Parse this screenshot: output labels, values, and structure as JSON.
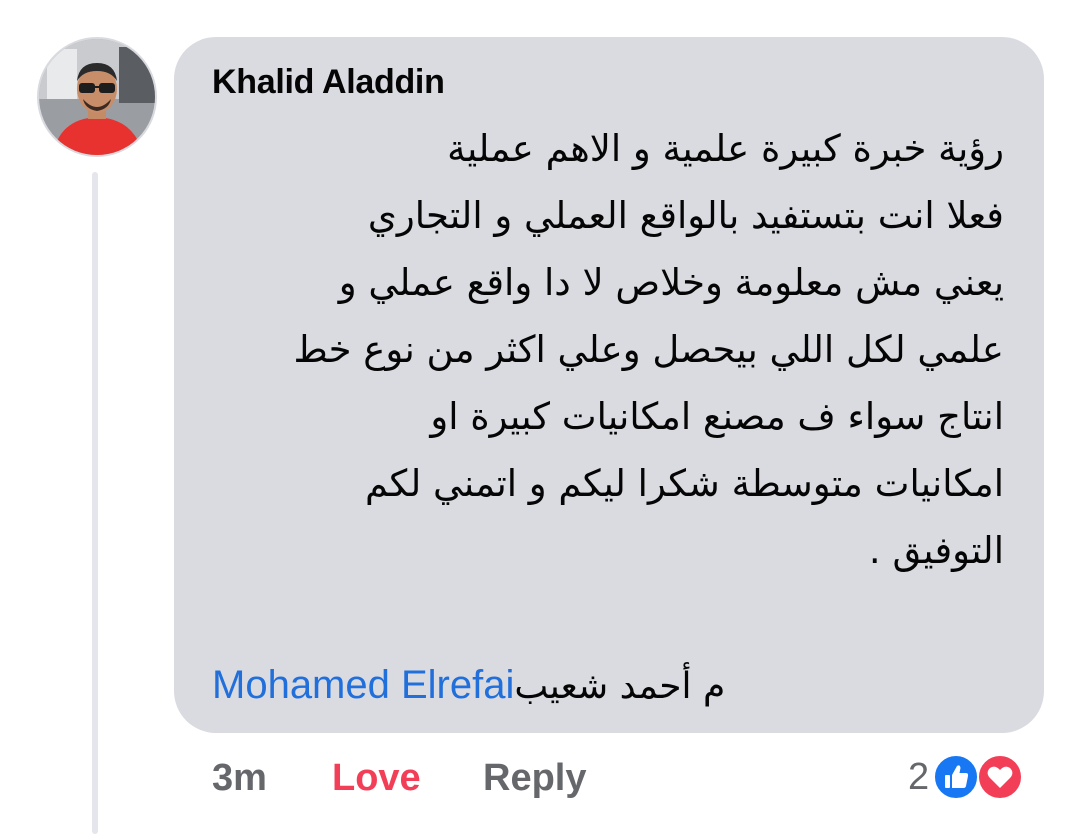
{
  "comment": {
    "author": "Khalid Aladdin",
    "lines": [
      "رؤية خبرة كبيرة علمية و الاهم عملية",
      "فعلا انت بتستفيد بالواقع العملي و التجاري",
      "يعني مش معلومة وخلاص لا دا واقع عملي و",
      "علمي لكل اللي بيحصل وعلي اكثر من نوع خط",
      "انتاج سواء ف مصنع امكانيات كبيرة او",
      "امكانيات متوسطة شكرا ليكم و اتمني لكم",
      "التوفيق ."
    ],
    "mention_name": "Mohamed Elrefai",
    "mention_rest": "م أحمد شعيب"
  },
  "actions": {
    "time": "3m",
    "love_label": "Love",
    "reply_label": "Reply"
  },
  "reactions": {
    "count": "2",
    "types": [
      "like-icon",
      "love-icon"
    ]
  },
  "colors": {
    "bubble": "#d9dbe1",
    "link": "#216fdb",
    "love": "#f33e58",
    "muted": "#65676b",
    "like": "#1877f2"
  }
}
